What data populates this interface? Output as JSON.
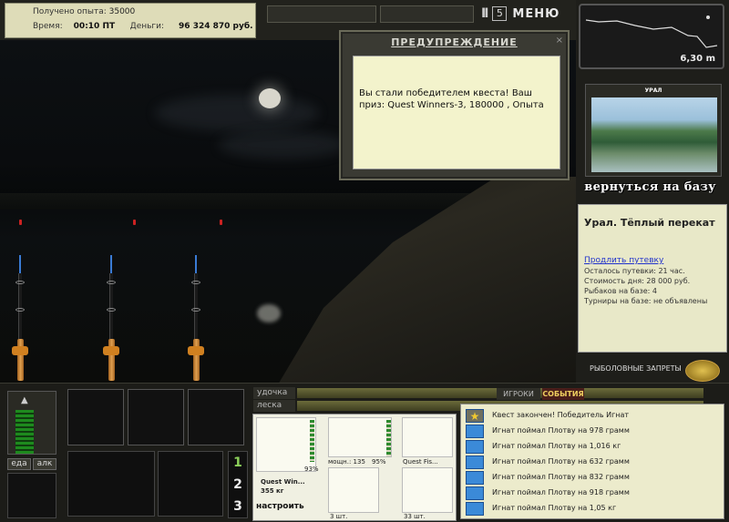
{
  "stats": {
    "xp_label": "Получено опыта:",
    "xp_value": "35000",
    "time_label": "Время:",
    "time_value": "00:10 ПТ",
    "money_label": "Деньги:",
    "money_value": "96 324 870 руб."
  },
  "controls": {
    "pause": "II",
    "speed": "5",
    "menu": "МЕНЮ"
  },
  "warning": {
    "title": "ПРЕДУПРЕЖДЕНИЕ",
    "close": "×",
    "message": "Вы стали победителем квеста! Ваш приз: Quest Winners-3, 180000 , Опыта"
  },
  "depth": {
    "value": "6,30 m"
  },
  "location": {
    "photo_label": "УРАЛ",
    "return_button": "вернуться на базу",
    "title": "Урал. Тёплый перекат",
    "extend_link": "Продлить путевку",
    "lines": [
      "Осталось путевки: 21 час.",
      "Стоимость дня: 28 000 руб.",
      "Рыбаков на базе: 4",
      "Турниры на базе: не объявлены"
    ],
    "bans_button": "РЫБОЛОВНЫЕ ЗАПРЕТЫ"
  },
  "bottom": {
    "eat": "еда",
    "alcohol": "алк",
    "rod_label": "удочка",
    "line_label": "леска",
    "numbers": [
      "1",
      "2",
      "3"
    ],
    "rod_percent": "93%",
    "rod_name": "Quest Win...",
    "rod_weight": "355 кг",
    "reel_power": "мощн.: 135",
    "reel_percent": "95%",
    "line_name": "Quest Fis...",
    "hook_count": "3 шт.",
    "bait_count": "33 шт.",
    "tune": "настроить"
  },
  "events": {
    "tab_players": "ИГРОКИ",
    "tab_events": "СОБЫТИЯ",
    "items": [
      {
        "icon": "star-icon",
        "text": "Квест закончен! Победитель Игнат"
      },
      {
        "icon": "fish-icon",
        "text": "Игнат поймал Плотву на 978 грамм"
      },
      {
        "icon": "fish-icon",
        "text": "Игнат поймал Плотву на 1,016 кг"
      },
      {
        "icon": "fish-icon",
        "text": "Игнат поймал Плотву на 632 грамм"
      },
      {
        "icon": "fish-icon",
        "text": "Игнат поймал Плотву на 832 грамм"
      },
      {
        "icon": "fish-icon",
        "text": "Игнат поймал Плотву на 918 грамм"
      },
      {
        "icon": "fish-icon",
        "text": "Игнат поймал Плотву на 1,05 кг"
      }
    ]
  }
}
